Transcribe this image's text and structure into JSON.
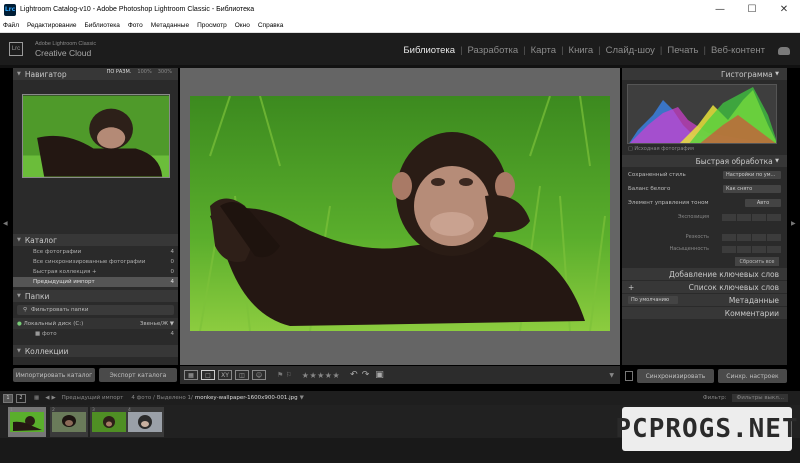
{
  "window": {
    "title": "Lightroom Catalog-v10 - Adobe Photoshop Lightroom Classic - Библиотека",
    "app_icon": "Lrc"
  },
  "menu": [
    "Файл",
    "Редактирование",
    "Библиотека",
    "Фото",
    "Метаданные",
    "Просмотр",
    "Окно",
    "Справка"
  ],
  "brand": {
    "line1": "Adobe Lightroom Classic",
    "line2": "Creative Cloud",
    "logo": "Lrc"
  },
  "modules": [
    "Библиотека",
    "Разработка",
    "Карта",
    "Книга",
    "Слайд-шоу",
    "Печать",
    "Веб-контент"
  ],
  "active_module": "Библиотека",
  "navigator": {
    "title": "Навигатор",
    "zoom_fit": "ПО РАЗМ.",
    "zoom_100": "100%",
    "zoom_300": "300%"
  },
  "catalog": {
    "title": "Каталог",
    "items": [
      {
        "label": "Все фотографии",
        "count": "4"
      },
      {
        "label": "Все синхронизированные фотографии",
        "count": "0"
      },
      {
        "label": "Быстрая коллекция +",
        "count": "0"
      },
      {
        "label": "Предыдущий импорт",
        "count": "4"
      }
    ]
  },
  "folders": {
    "title": "Папки",
    "filter": "Фильтровать папки",
    "disk": "Локальный диск (C:)",
    "disk_space": "Звенье/Ж",
    "sub": "фото",
    "sub_count": "4"
  },
  "collections": {
    "title": "Коллекции"
  },
  "left_buttons": {
    "import": "Импортировать каталог",
    "export": "Экспорт каталога"
  },
  "histogram": {
    "title": "Гистограмма",
    "label": "Исходная фотография"
  },
  "quick_develop": {
    "title": "Быстрая обработка",
    "saved_preset_label": "Сохраненный стиль",
    "saved_preset_value": "Настройки по ум...",
    "wb_label": "Баланс белого",
    "wb_value": "Как снято",
    "tone_label": "Элемент управления тоном",
    "tone_btn": "Авто",
    "exposure": "Экспозиция",
    "clarity": "Резкость",
    "vibrance": "Насыщенность",
    "reset": "Сбросить все"
  },
  "right_sections": [
    "Добавление ключевых слов",
    "Список ключевых слов",
    "Метаданные",
    "Комментарии"
  ],
  "meta_preset": "По умолчанию",
  "right_buttons": {
    "sync": "Синхронизировать",
    "sync_settings": "Синхр. настроек"
  },
  "toolbar": {
    "stars": "★★★★★"
  },
  "filmbar": {
    "page1": "1",
    "page2": "2",
    "source": "Предыдущий импорт",
    "count": "4 фото / Выделено 1/",
    "file": "monkey-wallpaper-1600x900-001.jpg",
    "filter_label": "Фильтр:",
    "filter_value": "Фильтры выкл..."
  },
  "film_numbers": [
    "1",
    "2",
    "3",
    "4"
  ],
  "watermark": "PCPROGS.NET"
}
